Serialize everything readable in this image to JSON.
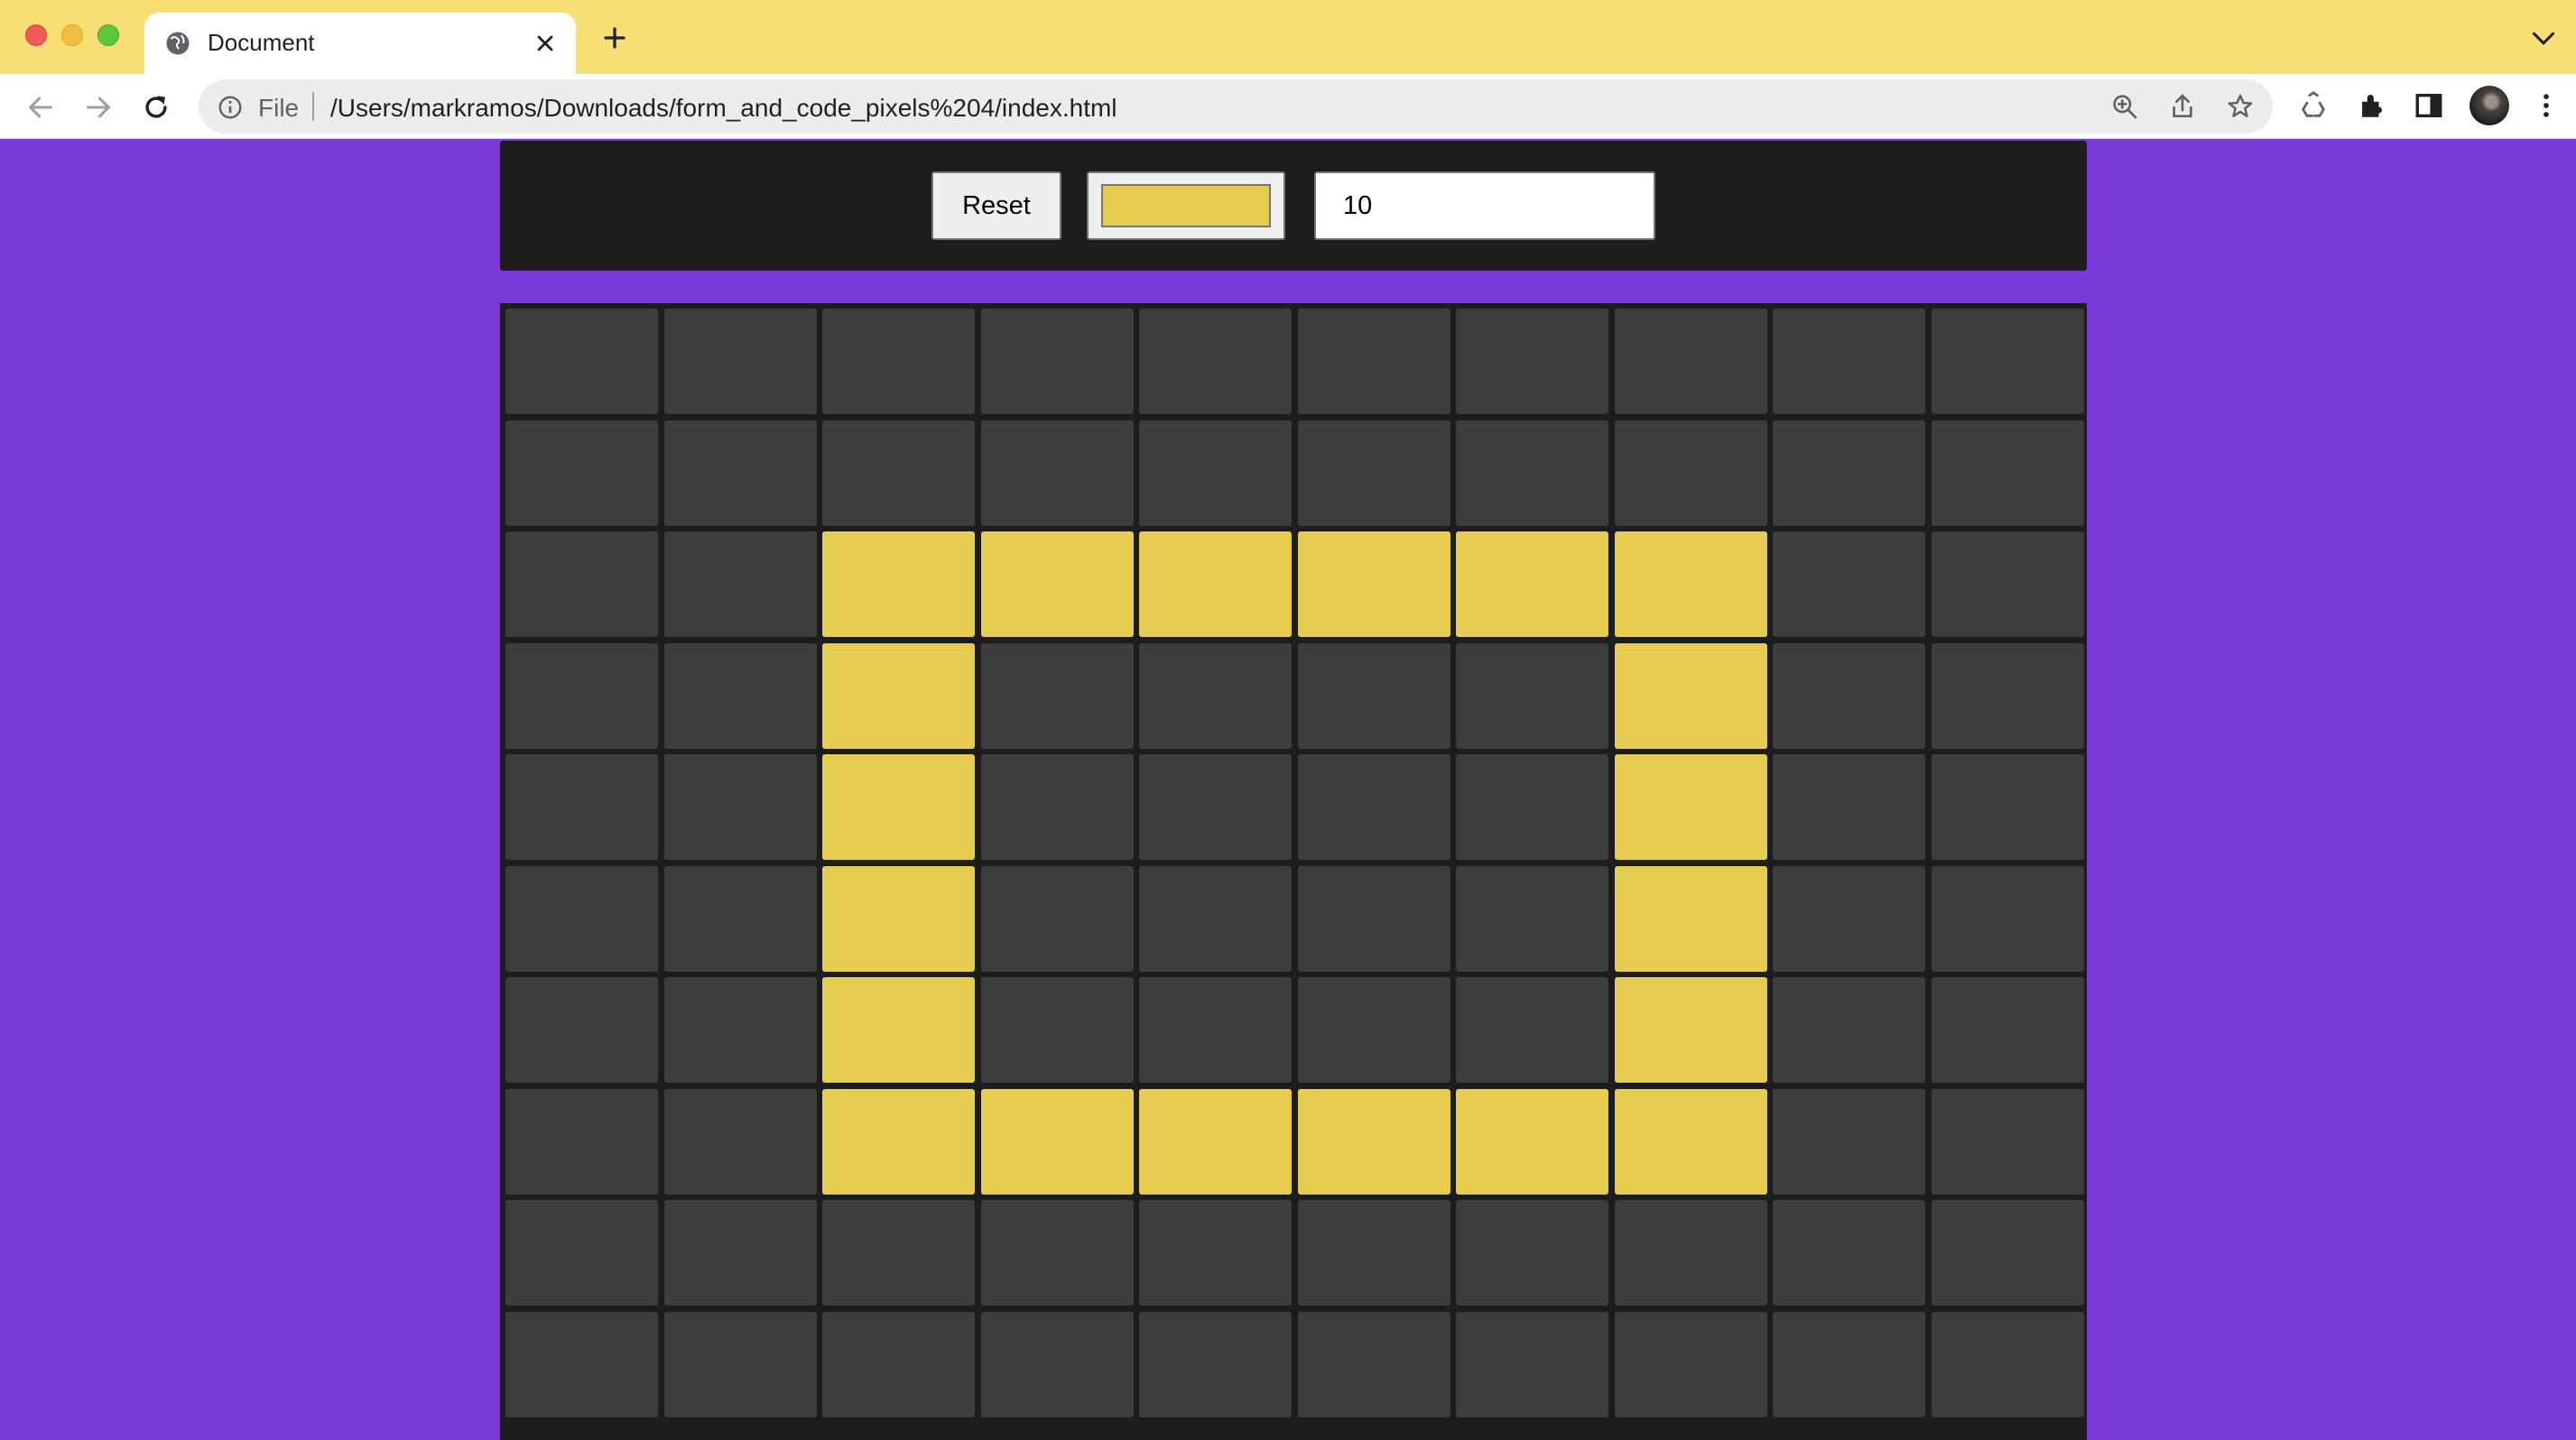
{
  "browser": {
    "tab_title": "Document",
    "omnibox": {
      "scheme_label": "File",
      "url": "/Users/markramos/Downloads/form_and_code_pixels%204/index.html"
    },
    "icons": [
      "close-window",
      "minimize-window",
      "maximize-window",
      "globe-icon",
      "close-tab-icon",
      "new-tab-icon",
      "tab-list-icon",
      "back-icon",
      "forward-icon",
      "reload-icon",
      "info-icon",
      "zoom-icon",
      "share-icon",
      "bookmark-star-icon",
      "recycle-icon",
      "extensions-icon",
      "side-panel-icon",
      "avatar"
    ]
  },
  "controls": {
    "reset_label": "Reset",
    "color_value": "#e6cd50",
    "grid_size_value": "10"
  },
  "grid": {
    "size": 10,
    "empty_color": "#3d3d3d",
    "paint_color": "#e6cd50",
    "filled": [
      [
        0,
        0,
        0,
        0,
        0,
        0,
        0,
        0,
        0,
        0
      ],
      [
        0,
        0,
        0,
        0,
        0,
        0,
        0,
        0,
        0,
        0
      ],
      [
        0,
        0,
        1,
        1,
        1,
        1,
        1,
        1,
        0,
        0
      ],
      [
        0,
        0,
        1,
        0,
        0,
        0,
        0,
        1,
        0,
        0
      ],
      [
        0,
        0,
        1,
        0,
        0,
        0,
        0,
        1,
        0,
        0
      ],
      [
        0,
        0,
        1,
        0,
        0,
        0,
        0,
        1,
        0,
        0
      ],
      [
        0,
        0,
        1,
        0,
        0,
        0,
        0,
        1,
        0,
        0
      ],
      [
        0,
        0,
        1,
        1,
        1,
        1,
        1,
        1,
        0,
        0
      ],
      [
        0,
        0,
        0,
        0,
        0,
        0,
        0,
        0,
        0,
        0
      ],
      [
        0,
        0,
        0,
        0,
        0,
        0,
        0,
        0,
        0,
        0
      ]
    ]
  },
  "colors": {
    "page_background": "#7b39d8",
    "tabbar": "#f9de75",
    "panel": "#1d1d1d"
  }
}
